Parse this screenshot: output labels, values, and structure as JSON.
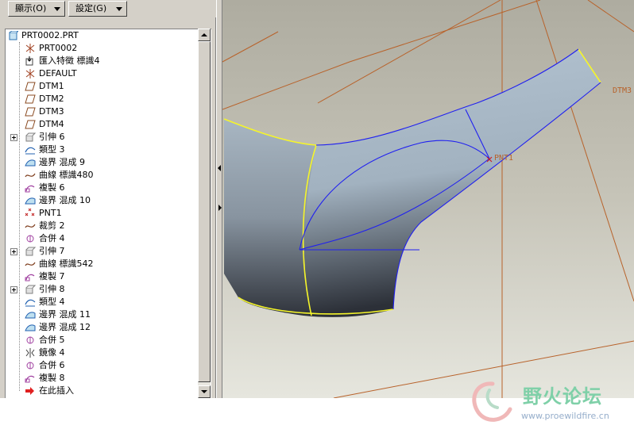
{
  "menu": {
    "display_label": "顯示(O)",
    "settings_label": "設定(G)"
  },
  "tree": {
    "root": "PRT0002.PRT",
    "items": [
      {
        "label": "PRT0002",
        "icon": "csys-icon",
        "expandable": false
      },
      {
        "label": "匯入特徵 標識4",
        "icon": "import-feature-icon",
        "expandable": false
      },
      {
        "label": "DEFAULT",
        "icon": "csys-icon",
        "expandable": false
      },
      {
        "label": "DTM1",
        "icon": "datum-plane-icon",
        "expandable": false
      },
      {
        "label": "DTM2",
        "icon": "datum-plane-icon",
        "expandable": false
      },
      {
        "label": "DTM3",
        "icon": "datum-plane-icon",
        "expandable": false
      },
      {
        "label": "DTM4",
        "icon": "datum-plane-icon",
        "expandable": false
      },
      {
        "label": "引伸 6",
        "icon": "extrude-icon",
        "expandable": true
      },
      {
        "label": "類型 3",
        "icon": "surface-type-icon",
        "expandable": false
      },
      {
        "label": "邊界 混成 9",
        "icon": "boundary-blend-icon",
        "expandable": false
      },
      {
        "label": "曲線 標識480",
        "icon": "curve-icon",
        "expandable": false
      },
      {
        "label": "複製 6",
        "icon": "copy-icon",
        "expandable": false
      },
      {
        "label": "邊界 混成 10",
        "icon": "boundary-blend-icon",
        "expandable": false
      },
      {
        "label": "PNT1",
        "icon": "datum-point-icon",
        "expandable": false
      },
      {
        "label": "裁剪 2",
        "icon": "trim-icon",
        "expandable": false
      },
      {
        "label": "合併 4",
        "icon": "merge-icon",
        "expandable": false
      },
      {
        "label": "引伸 7",
        "icon": "extrude-icon",
        "expandable": true
      },
      {
        "label": "曲線 標識542",
        "icon": "curve-icon",
        "expandable": false
      },
      {
        "label": "複製 7",
        "icon": "copy-icon",
        "expandable": false
      },
      {
        "label": "引伸 8",
        "icon": "extrude-icon",
        "expandable": true
      },
      {
        "label": "類型 4",
        "icon": "surface-type-icon",
        "expandable": false
      },
      {
        "label": "邊界 混成 11",
        "icon": "boundary-blend-icon",
        "expandable": false
      },
      {
        "label": "邊界 混成 12",
        "icon": "boundary-blend-icon",
        "expandable": false
      },
      {
        "label": "合併 5",
        "icon": "merge-icon",
        "expandable": false
      },
      {
        "label": "鏡像 4",
        "icon": "mirror-icon",
        "expandable": false
      },
      {
        "label": "合併 6",
        "icon": "merge-icon",
        "expandable": false
      },
      {
        "label": "複製 8",
        "icon": "copy-icon",
        "expandable": false
      },
      {
        "label": "在此插入",
        "icon": "insert-here-arrow-icon",
        "expandable": false
      }
    ]
  },
  "viewport": {
    "dtm3_label": "DTM3",
    "pnt1_label": "PNT1"
  },
  "watermark": {
    "name": "野火论坛",
    "url": "www.proewildfire.cn"
  },
  "colors": {
    "panel_bg": "#d4d0c8",
    "datum_plane": "#b8622a",
    "surface_edge": "#ffff33",
    "curve": "#2020ff",
    "surface_fill": "#a9b6c2"
  }
}
